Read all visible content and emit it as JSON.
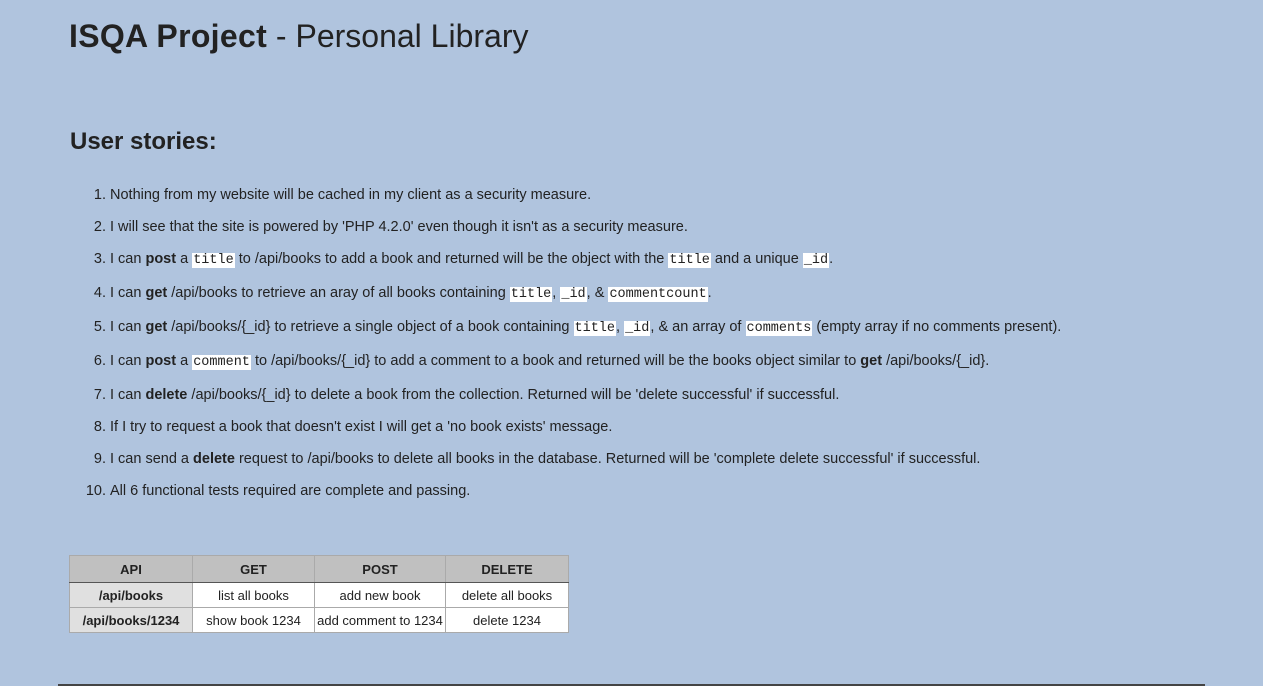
{
  "header": {
    "title_strong": "ISQA Project",
    "title_rest": " - Personal Library"
  },
  "stories": {
    "heading": "User stories:",
    "items": [
      [
        {
          "t": "Nothing from my website will be cached in my client as a security measure."
        }
      ],
      [
        {
          "t": "I will see that the site is powered by 'PHP 4.2.0' even though it isn't as a security measure."
        }
      ],
      [
        {
          "t": "I can "
        },
        {
          "b": "post"
        },
        {
          "t": " a "
        },
        {
          "c": "title"
        },
        {
          "t": " to /api/books to add a book and returned will be the object with the "
        },
        {
          "c": "title"
        },
        {
          "t": " and a unique "
        },
        {
          "c": "_id"
        },
        {
          "t": "."
        }
      ],
      [
        {
          "t": "I can "
        },
        {
          "b": "get"
        },
        {
          "t": " /api/books to retrieve an aray of all books containing "
        },
        {
          "c": "title"
        },
        {
          "t": ", "
        },
        {
          "c": "_id"
        },
        {
          "t": ", & "
        },
        {
          "c": "commentcount"
        },
        {
          "t": "."
        }
      ],
      [
        {
          "t": "I can "
        },
        {
          "b": "get"
        },
        {
          "t": " /api/books/{_id} to retrieve a single object of a book containing "
        },
        {
          "c": "title"
        },
        {
          "t": ", "
        },
        {
          "c": "_id"
        },
        {
          "t": ", & an array of "
        },
        {
          "c": "comments"
        },
        {
          "t": " (empty array if no comments present)."
        }
      ],
      [
        {
          "t": "I can "
        },
        {
          "b": "post"
        },
        {
          "t": " a "
        },
        {
          "c": "comment"
        },
        {
          "t": " to /api/books/{_id} to add a comment to a book and returned will be the books object similar to "
        },
        {
          "b": "get"
        },
        {
          "t": " /api/books/{_id}."
        }
      ],
      [
        {
          "t": "I can "
        },
        {
          "b": "delete"
        },
        {
          "t": " /api/books/{_id} to delete a book from the collection. Returned will be 'delete successful' if successful."
        }
      ],
      [
        {
          "t": "If I try to request a book that doesn't exist I will get a 'no book exists' message."
        }
      ],
      [
        {
          "t": "I can send a "
        },
        {
          "b": "delete"
        },
        {
          "t": " request to /api/books to delete all books in the database. Returned will be 'complete delete successful' if successful."
        }
      ],
      [
        {
          "t": "All 6 functional tests required are complete and passing."
        }
      ]
    ]
  },
  "api_table": {
    "headers": [
      "API",
      "GET",
      "POST",
      "DELETE"
    ],
    "rows": [
      [
        "/api/books",
        "list all books",
        "add new book",
        "delete all books"
      ],
      [
        "/api/books/1234",
        "show book 1234",
        "add comment to 1234",
        "delete 1234"
      ]
    ]
  }
}
